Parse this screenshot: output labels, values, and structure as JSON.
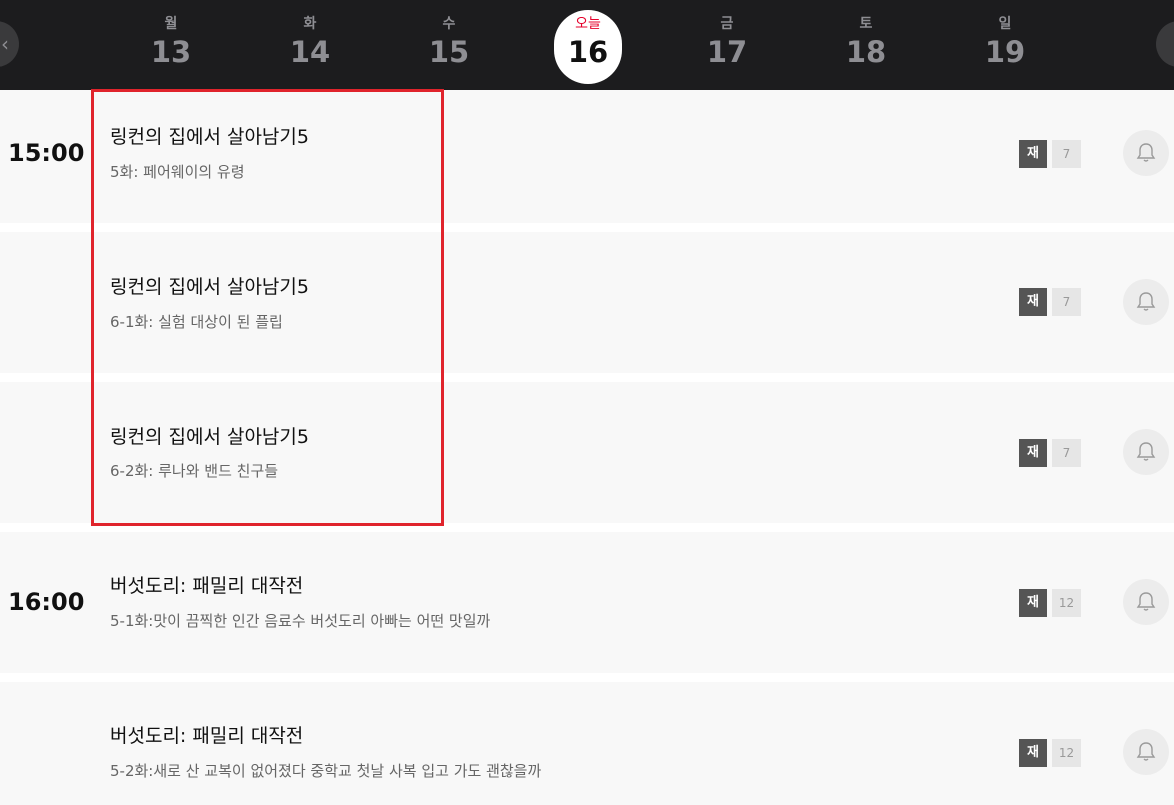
{
  "calendar": {
    "prev_icon": "chevron-left-icon",
    "next_icon": "chevron-right-icon",
    "days": [
      {
        "dow": "월",
        "num": "13"
      },
      {
        "dow": "화",
        "num": "14"
      },
      {
        "dow": "수",
        "num": "15"
      },
      {
        "dow": "오늘",
        "num": "16",
        "today": true
      },
      {
        "dow": "금",
        "num": "17"
      },
      {
        "dow": "토",
        "num": "18"
      },
      {
        "dow": "일",
        "num": "19"
      }
    ]
  },
  "schedule": [
    {
      "time": "15:00",
      "title": "링컨의 집에서 살아남기5",
      "episode": "5화: 페어웨이의 유령",
      "rerun": "재",
      "age": "7"
    },
    {
      "time": "",
      "title": "링컨의 집에서 살아남기5",
      "episode": "6-1화: 실험 대상이 된 플립",
      "rerun": "재",
      "age": "7"
    },
    {
      "time": "",
      "title": "링컨의 집에서 살아남기5",
      "episode": "6-2화: 루나와 밴드 친구들",
      "rerun": "재",
      "age": "7"
    },
    {
      "time": "16:00",
      "title": "버섯도리: 패밀리 대작전",
      "episode": "5-1화:맛이 끔찍한 인간 음료수 버섯도리 아빠는 어떤 맛일까",
      "rerun": "재",
      "age": "12"
    },
    {
      "time": "",
      "title": "버섯도리: 패밀리 대작전",
      "episode": "5-2화:새로 산 교복이 없어졌다 중학교 첫날 사복 입고 가도 괜찮을까",
      "rerun": "재",
      "age": "12"
    }
  ],
  "colors": {
    "accent": "#e5002b",
    "header_bg": "#1c1c1e",
    "highlight": "#e0242c"
  }
}
